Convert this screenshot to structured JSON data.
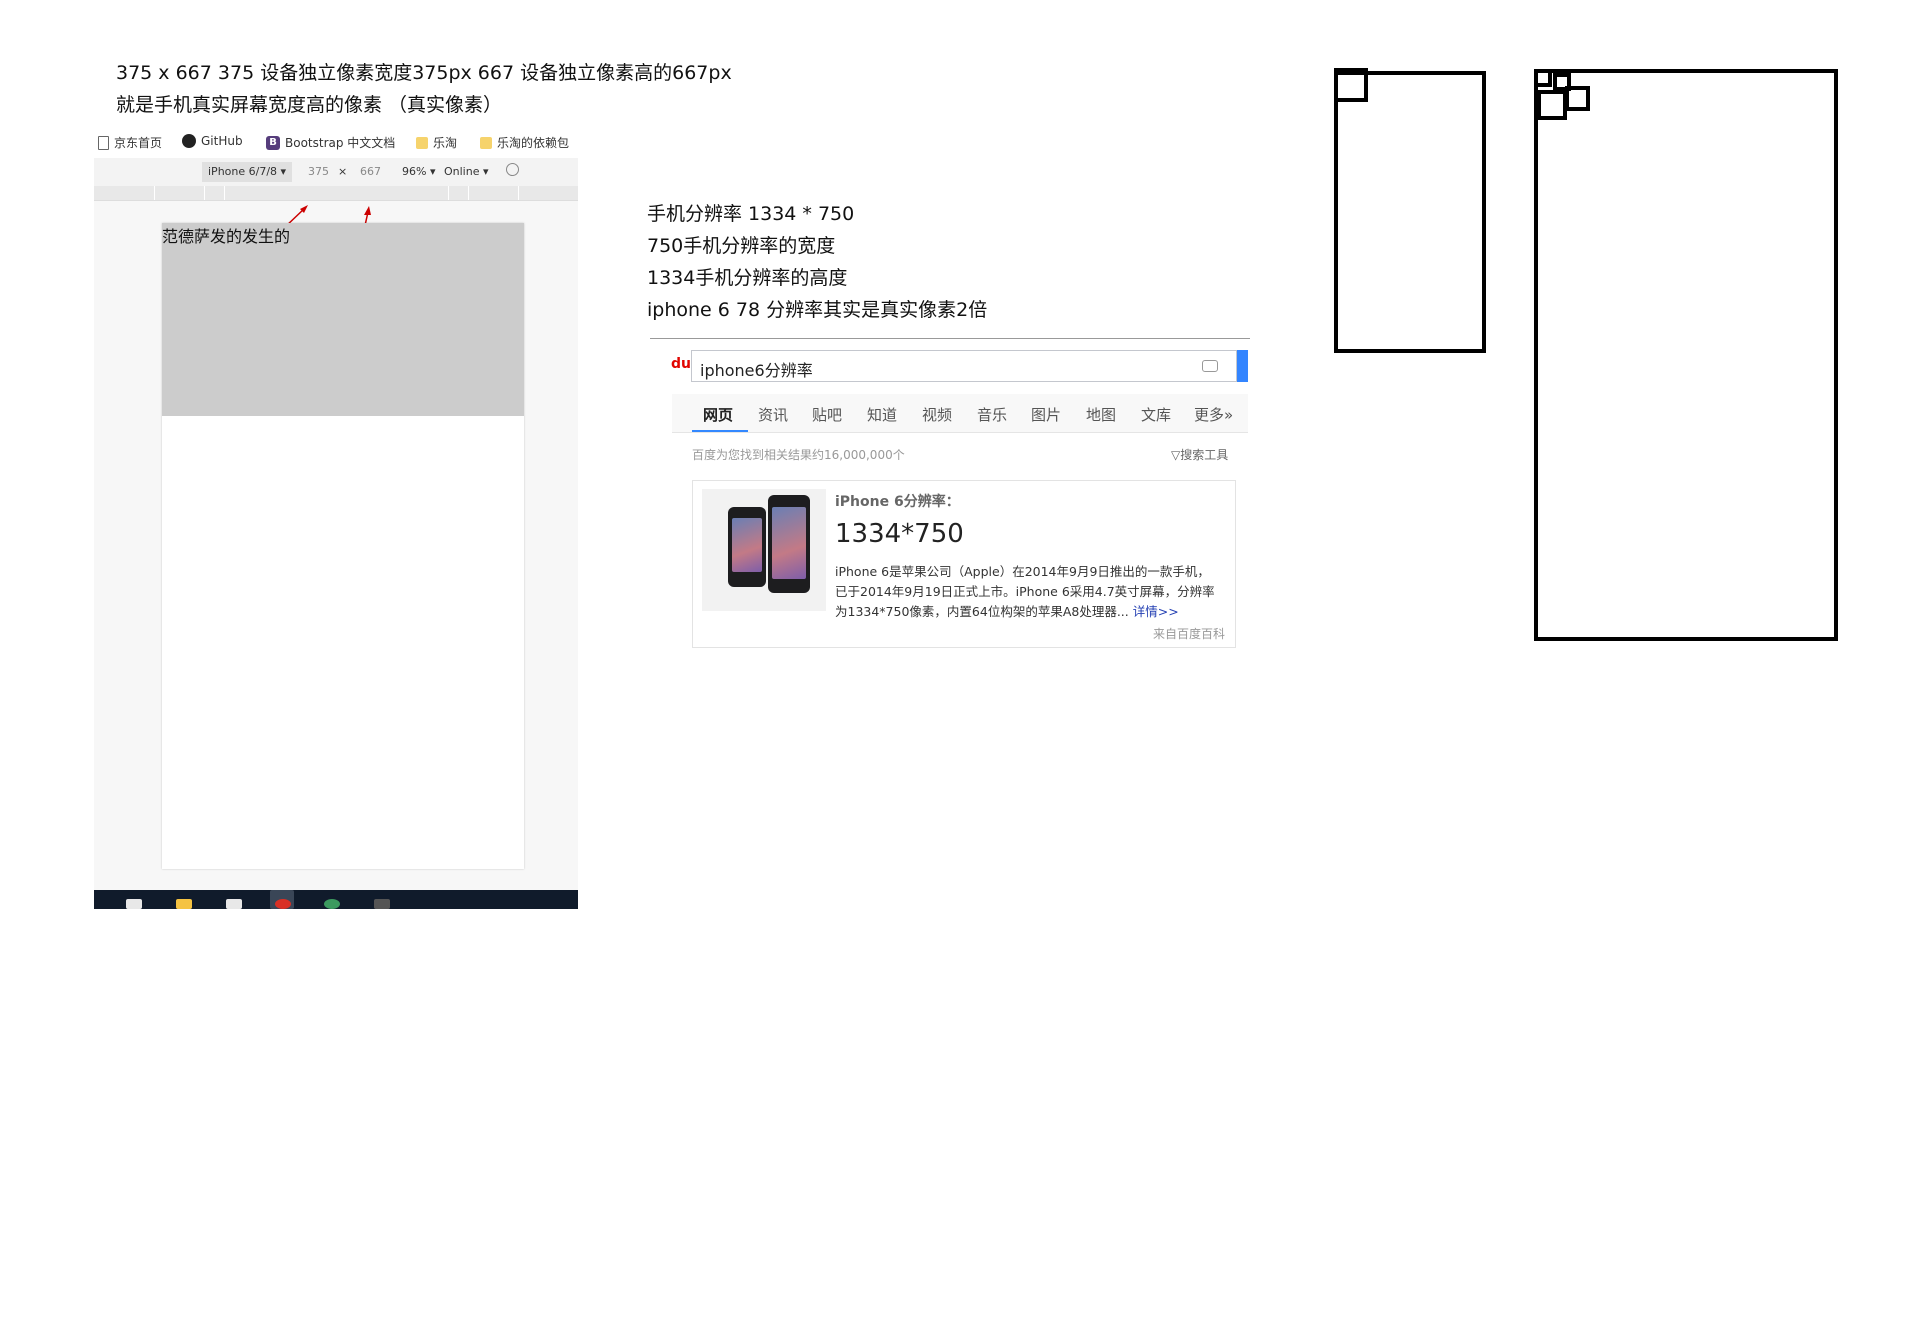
{
  "notes": {
    "line1": "375 x 667  375 设备独立像素宽度375px   667 设备独立像素高的667px",
    "line2": "就是手机真实屏幕宽度高的像素 （真实像素）"
  },
  "devtools": {
    "bookmarks": [
      {
        "icon": "page-icon",
        "label": "京东首页"
      },
      {
        "icon": "github-icon",
        "label": "GitHub"
      },
      {
        "icon": "bootstrap-icon",
        "label": "Bootstrap 中文文档"
      },
      {
        "icon": "folder-icon",
        "label": "乐淘"
      },
      {
        "icon": "folder-icon",
        "label": "乐淘的依赖包"
      }
    ],
    "device_bar": {
      "device": "iPhone 6/7/8 ▾",
      "width": "375",
      "times": "×",
      "height": "667",
      "zoom": "96% ▾",
      "network": "Online ▾",
      "rotate_icon": "rotate-icon"
    },
    "page_text": "范德萨发的发生的"
  },
  "middle_notes": {
    "line1": "手机分辨率 1334 * 750",
    "line2": "750手机分辨率的宽度",
    "line3": "1334手机分辨率的高度",
    "line4": "iphone 6 78 分辨率其实是真实像素2倍"
  },
  "baidu": {
    "logo": "du",
    "query": "iphone6分辨率",
    "tabs": [
      "网页",
      "资讯",
      "贴吧",
      "知道",
      "视频",
      "音乐",
      "图片",
      "地图",
      "文库",
      "更多»"
    ],
    "result_count": "百度为您找到相关结果约16,000,000个",
    "search_tools": "▽搜索工具",
    "card": {
      "title": "iPhone 6分辨率：",
      "value": "1334*750",
      "desc1": "iPhone 6是苹果公司（Apple）在2014年9月9日推出的一款手机，",
      "desc2": "已于2014年9月19日正式上市。iPhone 6采用4.7英寸屏幕，分辨率",
      "desc3": "为1334*750像素，内置64位构架的苹果A8处理器...",
      "more": "详情>>",
      "source": "来自百度百科"
    }
  },
  "arrow_color": "#cc0000"
}
